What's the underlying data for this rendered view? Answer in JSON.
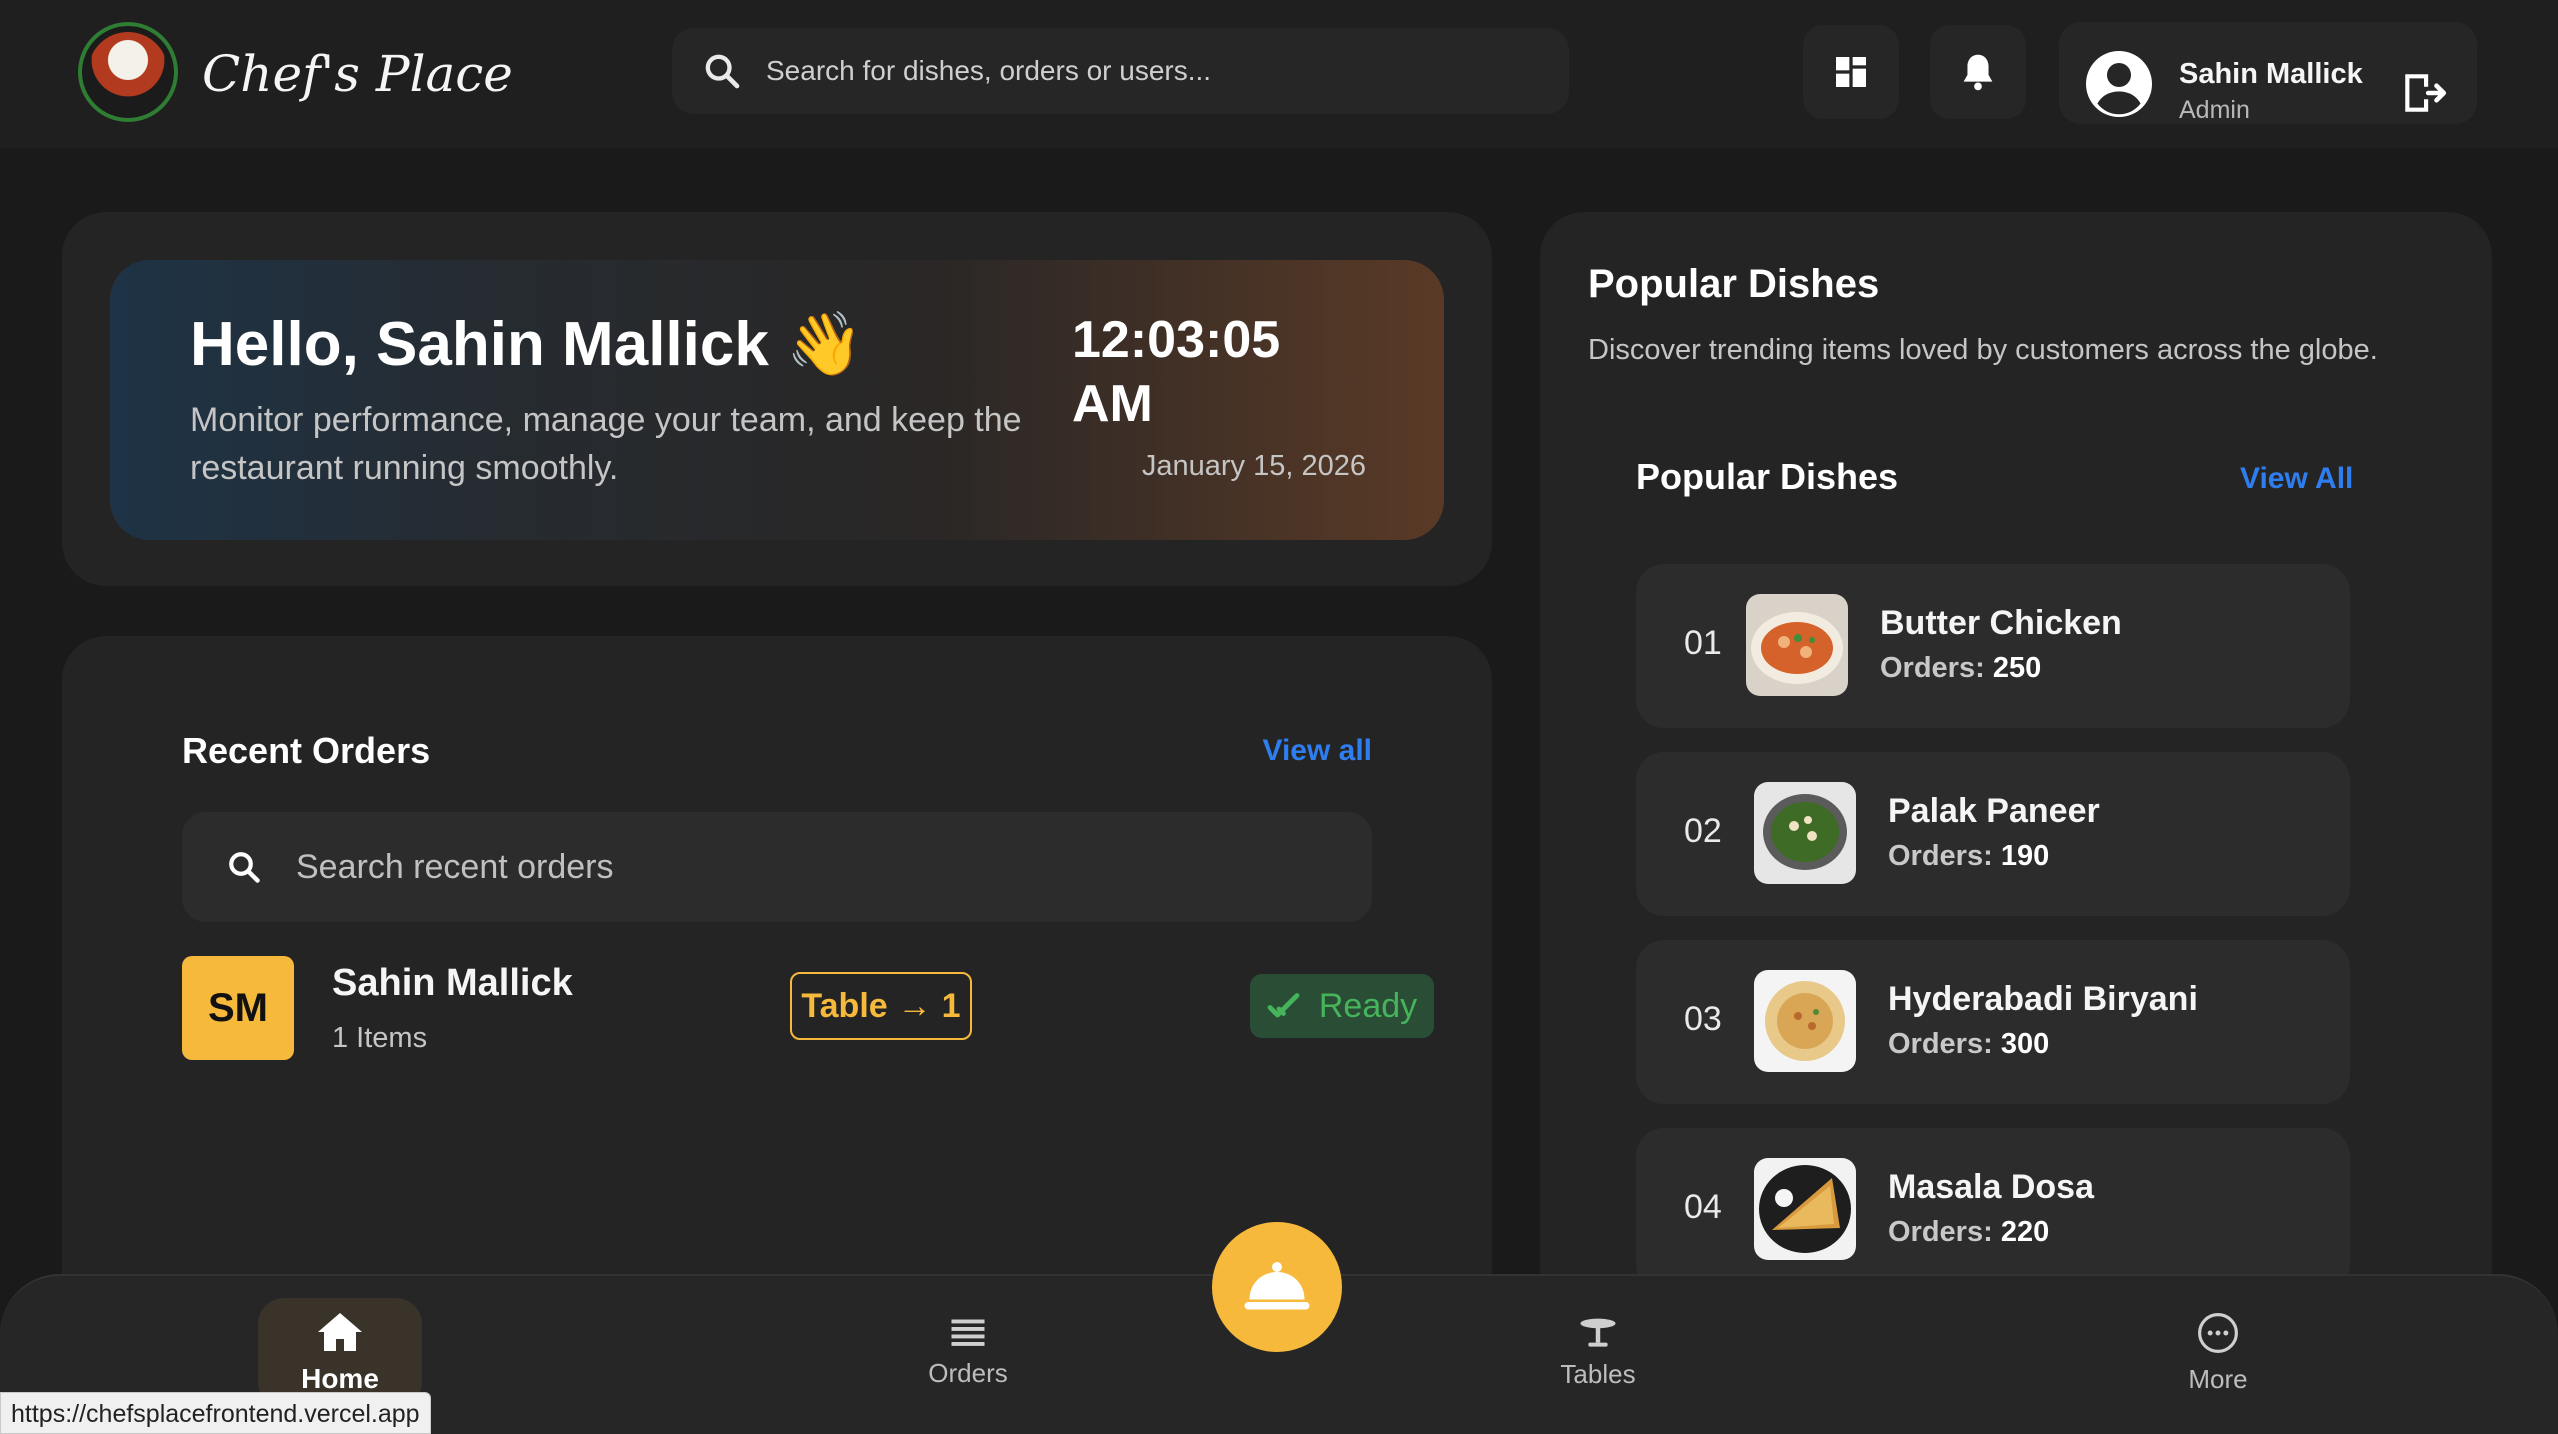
{
  "header": {
    "brand": "Chef's Place",
    "search_placeholder": "Search for dishes, orders or users...",
    "user": {
      "name": "Sahin Mallick",
      "role": "Admin"
    },
    "icons": [
      "dashboard-icon",
      "bell-icon",
      "user-avatar-icon",
      "logout-icon"
    ]
  },
  "welcome": {
    "greeting": "Hello, Sahin Mallick 👋",
    "description": "Monitor performance, manage your team, and keep the restaurant running smoothly.",
    "time": "12:03:05 AM",
    "date": "January 15, 2026"
  },
  "recent_orders": {
    "title": "Recent Orders",
    "view_all": "View all",
    "search_placeholder": "Search recent orders",
    "orders": [
      {
        "initials": "SM",
        "customer": "Sahin Mallick",
        "items": "1 Items",
        "table_label": "Table",
        "table_arrow": "→",
        "table_number": "1",
        "status": "Ready"
      }
    ]
  },
  "popular": {
    "heading": "Popular Dishes",
    "subtitle": "Discover trending items loved by customers across the globe.",
    "list_title": "Popular Dishes",
    "view_all": "View All",
    "orders_label": "Orders:",
    "dishes": [
      {
        "rank": "01",
        "name": "Butter Chicken",
        "orders": "250"
      },
      {
        "rank": "02",
        "name": "Palak Paneer",
        "orders": "190"
      },
      {
        "rank": "03",
        "name": "Hyderabadi Biryani",
        "orders": "300"
      },
      {
        "rank": "04",
        "name": "Masala Dosa",
        "orders": "220"
      }
    ]
  },
  "nav": {
    "items": [
      {
        "label": "Home",
        "icon": "home-icon",
        "active": true
      },
      {
        "label": "Orders",
        "icon": "orders-icon",
        "active": false
      },
      {
        "label": "Tables",
        "icon": "tables-icon",
        "active": false
      },
      {
        "label": "More",
        "icon": "more-icon",
        "active": false
      }
    ],
    "fab_icon": "cloche-icon"
  },
  "status_bar_url": "https://chefsplacefrontend.vercel.app",
  "colors": {
    "accent": "#f6b93b",
    "link": "#2f7ef0",
    "ready_bg": "#2a4d35",
    "ready_text": "#46b45a",
    "background": "#1a1a1a",
    "card": "#242424"
  }
}
